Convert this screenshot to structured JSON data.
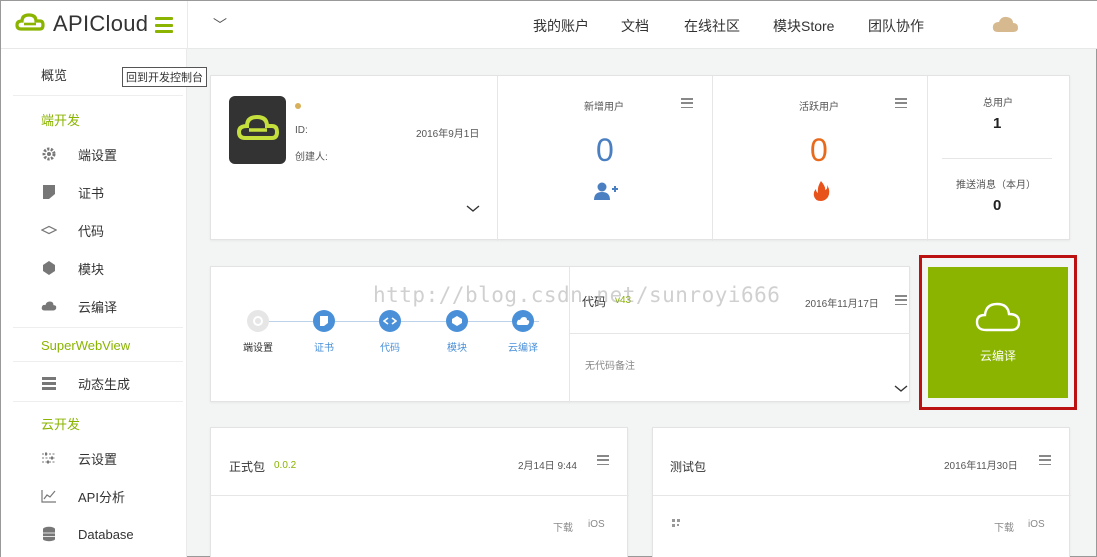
{
  "brand": {
    "name": "APICloud",
    "accent": "#8ab400"
  },
  "topnav": {
    "dropdown": "﹀",
    "items": [
      "我的账户",
      "文档",
      "在线社区",
      "模块Store",
      "团队协作"
    ]
  },
  "sidebar": {
    "overview": "概览",
    "tooltip": "回到开发控制台",
    "section_dev": "端开发",
    "dev_items": [
      {
        "label": "端设置",
        "icon": "gear-icon"
      },
      {
        "label": "证书",
        "icon": "certificate-icon"
      },
      {
        "label": "代码",
        "icon": "code-icon"
      },
      {
        "label": "模块",
        "icon": "module-icon"
      },
      {
        "label": "云编译",
        "icon": "cloud-icon"
      }
    ],
    "section_swv": "SuperWebView",
    "swv_items": [
      {
        "label": "动态生成",
        "icon": "layers-icon"
      }
    ],
    "section_cloud": "云开发",
    "cloud_items": [
      {
        "label": "云设置",
        "icon": "sliders-icon"
      },
      {
        "label": "API分析",
        "icon": "chart-icon"
      },
      {
        "label": "Database",
        "icon": "database-icon"
      }
    ]
  },
  "app_card": {
    "id_label": "ID:",
    "date": "2016年9月1日",
    "creator_label": "创建人:"
  },
  "stats": {
    "new_users": {
      "label": "新增用户",
      "value": "0"
    },
    "active_users": {
      "label": "活跃用户",
      "value": "0"
    },
    "total_users": {
      "label": "总用户",
      "value": "1"
    },
    "push_msgs": {
      "label": "推送消息（本月）",
      "value": "0"
    }
  },
  "steps": [
    {
      "label": "端设置",
      "state": "grey"
    },
    {
      "label": "证书",
      "state": "blue"
    },
    {
      "label": "代码",
      "state": "blue"
    },
    {
      "label": "模块",
      "state": "blue"
    },
    {
      "label": "云编译",
      "state": "blue"
    }
  ],
  "code_panel": {
    "title": "代码",
    "version": "v43",
    "date": "2016年11月17日",
    "note": "无代码备注"
  },
  "compile_button": {
    "label": "云编译"
  },
  "release_pkg": {
    "title": "正式包",
    "version": "0.0.2",
    "date": "2月14日 9:44",
    "download": "下载",
    "platform": "iOS"
  },
  "test_pkg": {
    "title": "测试包",
    "date": "2016年11月30日",
    "download": "下载",
    "platform": "iOS"
  },
  "watermark": "http://blog.csdn.net/sunroyi666"
}
